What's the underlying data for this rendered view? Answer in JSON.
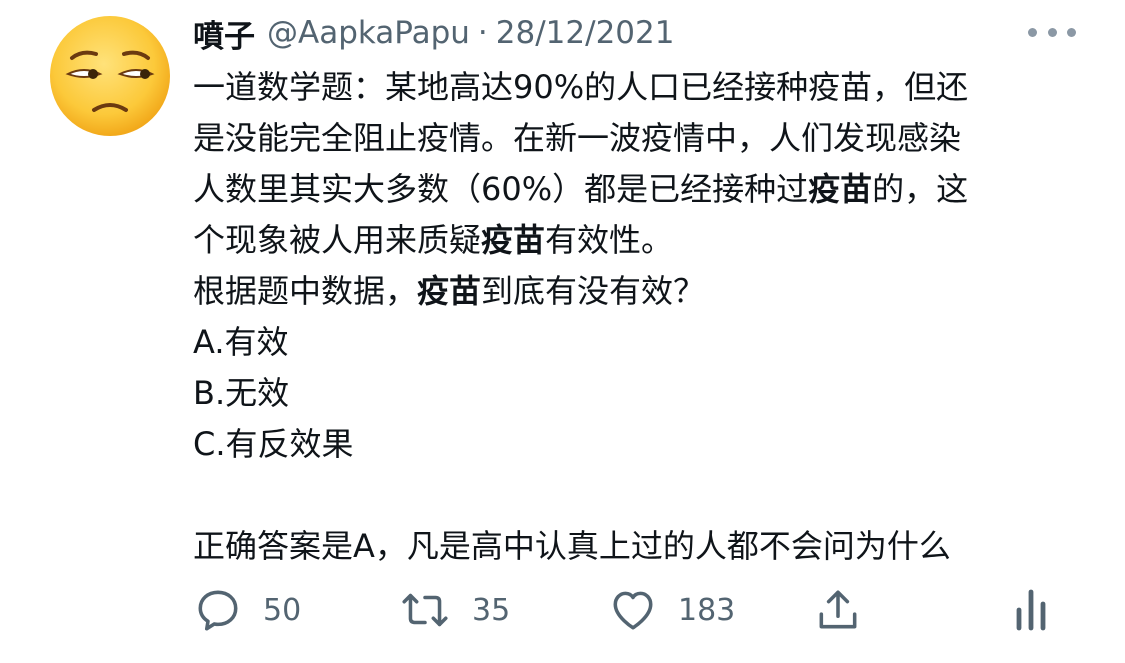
{
  "author": {
    "display_name": "噴子",
    "handle": "@AapkaPapu",
    "separator": "·",
    "date": "28/12/2021",
    "avatar_icon": "unamused-face-emoji"
  },
  "tweet": {
    "line1": "一道数学题：某地高达90%的人口已经接种疫苗，但还",
    "line2": "是没能完全阻止疫情。在新一波疫情中，人们发现感染",
    "line3_a": "人数里其实大多数（60%）都是已经接种过",
    "line3_bold": "疫苗",
    "line3_b": "的，这",
    "line4_a": "个现象被人用来质疑",
    "line4_bold": "疫苗",
    "line4_b": "有效性。",
    "line5_a": "根据题中数据，",
    "line5_bold": "疫苗",
    "line5_b": "到底有没有效？",
    "option_a": "A.有效",
    "option_b": "B.无效",
    "option_c": "C.有反效果",
    "answer": "正确答案是A，凡是高中认真上过的人都不会问为什么"
  },
  "actions": {
    "reply_count": "50",
    "retweet_count": "35",
    "like_count": "183"
  },
  "colors": {
    "text": "#0f1419",
    "secondary": "#536471",
    "icon": "#536471"
  }
}
